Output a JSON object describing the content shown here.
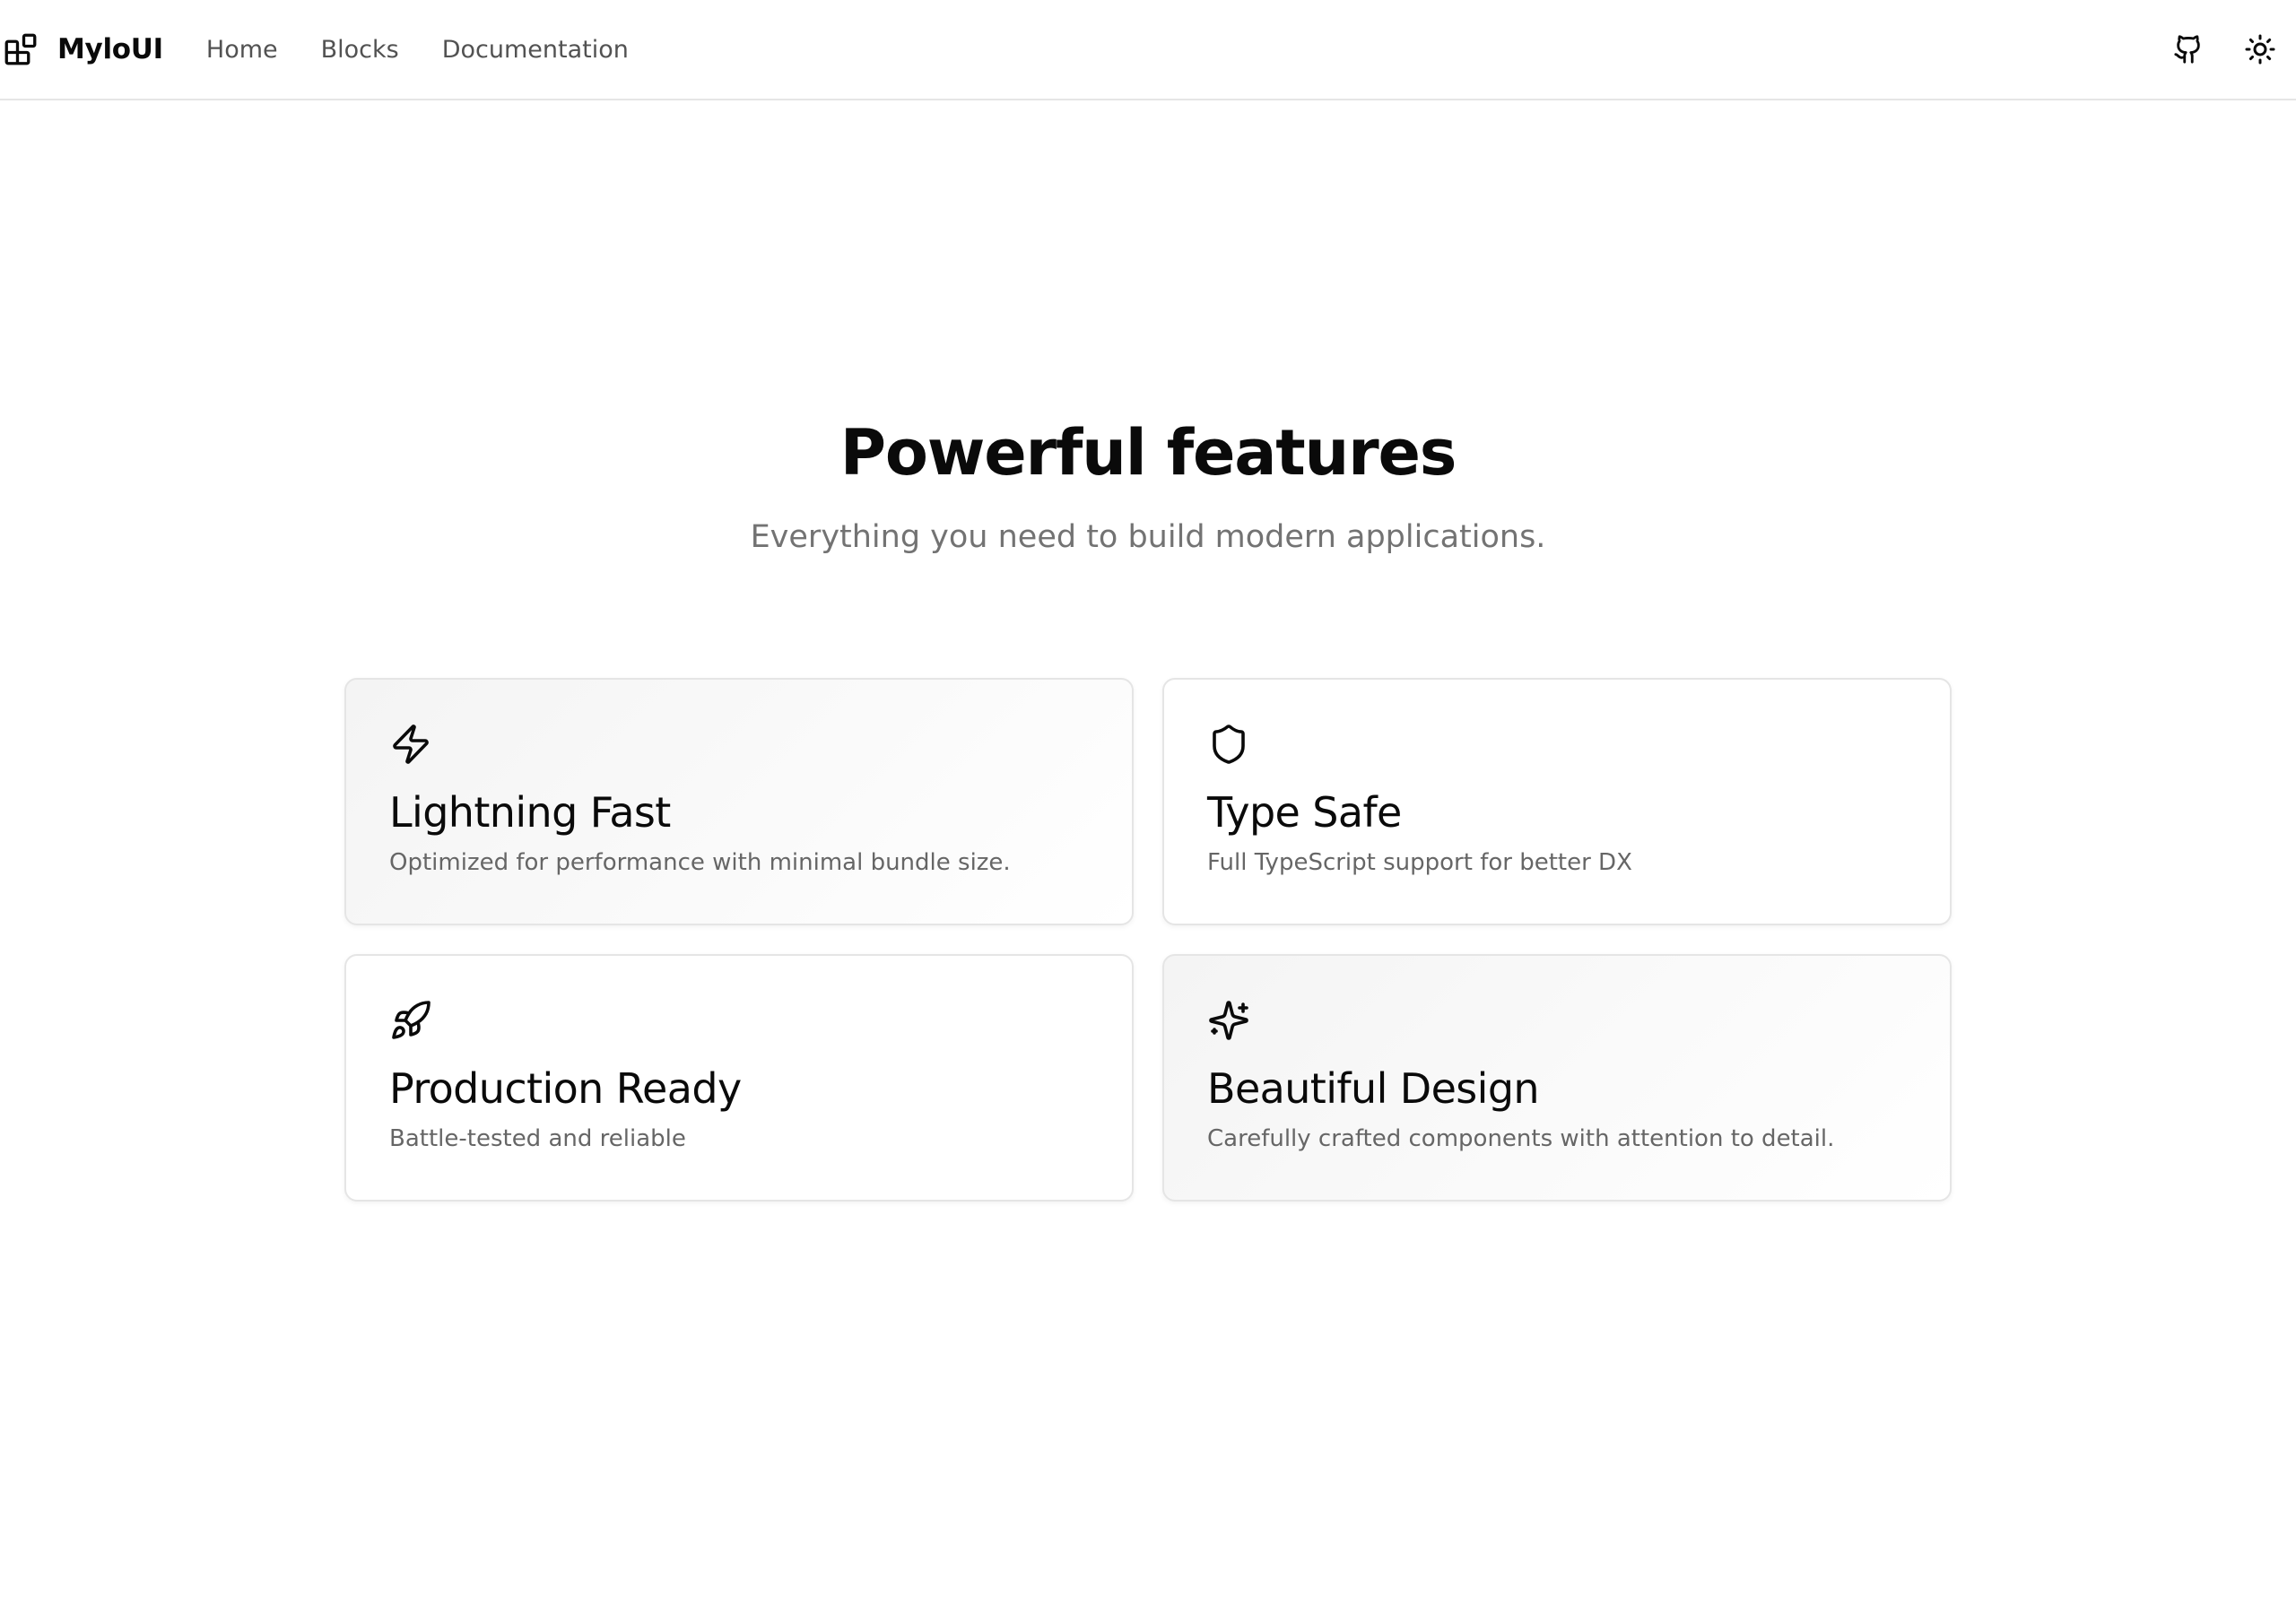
{
  "navbar": {
    "brand": "MyloUI",
    "brand_icon": "blocks-icon",
    "links": [
      {
        "label": "Home"
      },
      {
        "label": "Blocks"
      },
      {
        "label": "Documentation"
      }
    ],
    "actions": [
      {
        "icon": "github-icon"
      },
      {
        "icon": "sun-icon"
      }
    ]
  },
  "hero": {
    "title": "Powerful features",
    "subtitle": "Everything you need to build modern applications."
  },
  "features": [
    {
      "icon": "lightning-icon",
      "title": "Lightning Fast",
      "description": "Optimized for performance with minimal bundle size."
    },
    {
      "icon": "shield-icon",
      "title": "Type Safe",
      "description": "Full TypeScript support for better DX"
    },
    {
      "icon": "rocket-icon",
      "title": "Production Ready",
      "description": "Battle-tested and reliable"
    },
    {
      "icon": "sparkles-icon",
      "title": "Beautiful Design",
      "description": "Carefully crafted components with attention to detail."
    }
  ],
  "colors": {
    "text_primary": "#0a0a0a",
    "text_muted": "#737373",
    "border": "#e5e5e5",
    "background": "#ffffff"
  }
}
